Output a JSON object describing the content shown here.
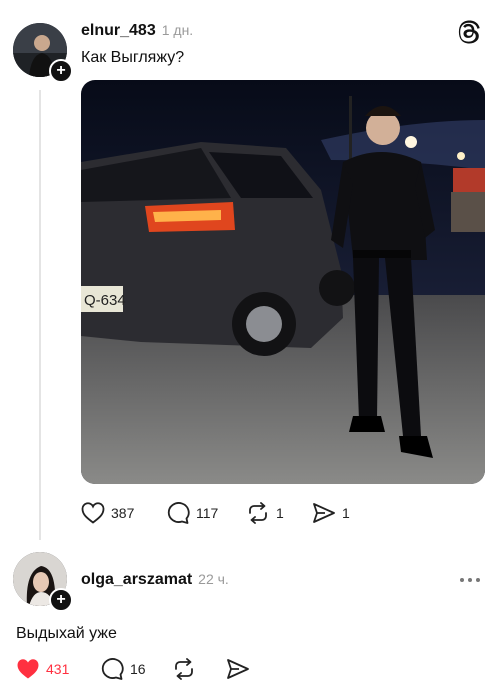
{
  "app": {
    "logo_icon": "threads-logo-icon"
  },
  "post": {
    "username": "elnur_483",
    "time": "1 дн.",
    "text": "Как Выгляжу?",
    "plate_text": "Q-634",
    "stats": {
      "likes": "387",
      "comments": "117",
      "reposts": "1",
      "shares": "1"
    }
  },
  "reply": {
    "username": "olga_arszamat",
    "time": "22 ч.",
    "text": "Выдыхай уже",
    "stats": {
      "likes": "431",
      "comments": "16"
    },
    "liked": true
  },
  "colors": {
    "like_red": "#ff3040",
    "text_gray": "#9a9a9a",
    "line_gray": "#e4e4e4"
  }
}
